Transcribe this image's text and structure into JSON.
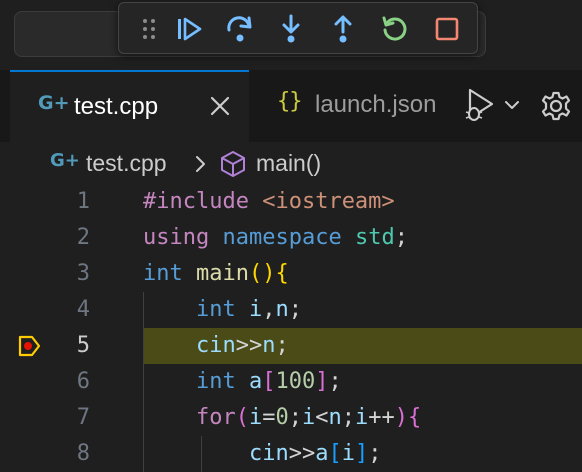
{
  "tabs": [
    {
      "label": "test.cpp",
      "active": true
    },
    {
      "label": "launch.json",
      "active": false
    }
  ],
  "breadcrumb": {
    "file": "test.cpp",
    "symbol": "main()"
  },
  "debug_toolbar": [
    "continue",
    "step-over",
    "step-into",
    "step-out",
    "restart",
    "stop"
  ],
  "editor": {
    "current_line": 5,
    "breakpoint_line": 5,
    "line_numbers": [
      "1",
      "2",
      "3",
      "4",
      "5",
      "6",
      "7",
      "8"
    ],
    "lines": [
      [
        {
          "t": "#include",
          "c": "t-ctl"
        },
        {
          "t": " ",
          "c": "t-op"
        },
        {
          "t": "<iostream>",
          "c": "t-str"
        }
      ],
      [
        {
          "t": "using",
          "c": "t-ctl"
        },
        {
          "t": " ",
          "c": "t-op"
        },
        {
          "t": "namespace",
          "c": "t-kw"
        },
        {
          "t": " ",
          "c": "t-op"
        },
        {
          "t": "std",
          "c": "t-ns"
        },
        {
          "t": ";",
          "c": "t-op"
        }
      ],
      [
        {
          "t": "int",
          "c": "t-kw"
        },
        {
          "t": " ",
          "c": "t-op"
        },
        {
          "t": "main",
          "c": "t-fn"
        },
        {
          "t": "()",
          "c": "t-br1"
        },
        {
          "t": "{",
          "c": "t-br1"
        }
      ],
      [
        {
          "t": "    ",
          "c": "t-op"
        },
        {
          "t": "int",
          "c": "t-kw"
        },
        {
          "t": " ",
          "c": "t-op"
        },
        {
          "t": "i",
          "c": "t-var"
        },
        {
          "t": ",",
          "c": "t-op"
        },
        {
          "t": "n",
          "c": "t-var"
        },
        {
          "t": ";",
          "c": "t-op"
        }
      ],
      [
        {
          "t": "    ",
          "c": "t-op"
        },
        {
          "t": "cin",
          "c": "t-var"
        },
        {
          "t": ">>",
          "c": "t-op"
        },
        {
          "t": "n",
          "c": "t-var"
        },
        {
          "t": ";",
          "c": "t-op"
        }
      ],
      [
        {
          "t": "    ",
          "c": "t-op"
        },
        {
          "t": "int",
          "c": "t-kw"
        },
        {
          "t": " ",
          "c": "t-op"
        },
        {
          "t": "a",
          "c": "t-var"
        },
        {
          "t": "[",
          "c": "t-br2"
        },
        {
          "t": "100",
          "c": "t-num"
        },
        {
          "t": "]",
          "c": "t-br2"
        },
        {
          "t": ";",
          "c": "t-op"
        }
      ],
      [
        {
          "t": "    ",
          "c": "t-op"
        },
        {
          "t": "for",
          "c": "t-ctl"
        },
        {
          "t": "(",
          "c": "t-br2"
        },
        {
          "t": "i",
          "c": "t-var"
        },
        {
          "t": "=",
          "c": "t-op"
        },
        {
          "t": "0",
          "c": "t-num"
        },
        {
          "t": ";",
          "c": "t-op"
        },
        {
          "t": "i",
          "c": "t-var"
        },
        {
          "t": "<",
          "c": "t-op"
        },
        {
          "t": "n",
          "c": "t-var"
        },
        {
          "t": ";",
          "c": "t-op"
        },
        {
          "t": "i",
          "c": "t-var"
        },
        {
          "t": "++",
          "c": "t-op"
        },
        {
          "t": ")",
          "c": "t-br2"
        },
        {
          "t": "{",
          "c": "t-br2"
        }
      ],
      [
        {
          "t": "        ",
          "c": "t-op"
        },
        {
          "t": "cin",
          "c": "t-var"
        },
        {
          "t": ">>",
          "c": "t-op"
        },
        {
          "t": "a",
          "c": "t-var"
        },
        {
          "t": "[",
          "c": "t-br3"
        },
        {
          "t": "i",
          "c": "t-var"
        },
        {
          "t": "]",
          "c": "t-br3"
        },
        {
          "t": ";",
          "c": "t-op"
        }
      ]
    ]
  },
  "colors": {
    "accent": "#0078d4",
    "debug_blue": "#75beff",
    "restart_green": "#89d185",
    "stop_red": "#f48771",
    "current_line_bg": "#4b4b18",
    "breakpoint_arrow": "#ffcc00",
    "breakpoint_dot": "#e51400"
  }
}
